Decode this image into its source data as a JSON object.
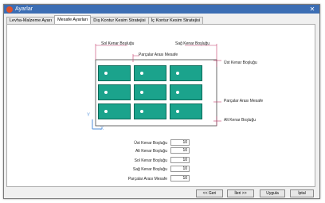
{
  "colors": {
    "title_bg": "#3c6eb4",
    "icon": "#e0502a",
    "part_fill": "#1ba38c",
    "dim_line": "#c43c6a",
    "axis": "#6aa0e0"
  },
  "window": {
    "title": "Ayarlar",
    "close_label": "✕"
  },
  "tabs": [
    {
      "label": "Levha-Malzeme Ayarı"
    },
    {
      "label": "Mesafe Ayarları"
    },
    {
      "label": "Dış Kontur Kesim Stratejisi"
    },
    {
      "label": "İç Kontur Kesim Stratejisi"
    }
  ],
  "diagram": {
    "sol_kenar": "Sol Kenar Boşluğu",
    "sag_kenar": "Sağ Kenar Boşluğu",
    "parca_arasi_top": "Parçalar Arası Mesafe",
    "ust_kenar": "Üst Kenar Boşluğu",
    "parca_arasi_right": "Parçalar Arası Mesafe",
    "alt_kenar": "Alt Kenar Boşluğu",
    "axis_y": "Y",
    "axis_x": "X"
  },
  "fields": [
    {
      "label": "Üst Kenar Boşluğu",
      "value": "10"
    },
    {
      "label": "Alt Kenar Boşluğu",
      "value": "10"
    },
    {
      "label": "Sol Kenar Boşluğu",
      "value": "10"
    },
    {
      "label": "Sağ Kenar Boşluğu",
      "value": "10"
    },
    {
      "label": "Parçalar Arası Mesafe",
      "value": "10"
    }
  ],
  "buttons": {
    "back": "<< Geri",
    "next": "İleri >>",
    "apply": "Uygula",
    "cancel": "İptal"
  }
}
